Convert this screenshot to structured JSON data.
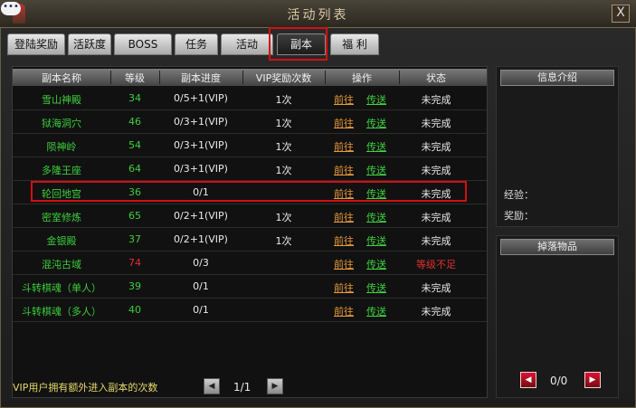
{
  "window": {
    "title": "活动列表",
    "close_label": "X"
  },
  "chat_icon": "speech-bubble-icon",
  "tabs": [
    {
      "label": "登陆奖励",
      "active": false
    },
    {
      "label": "活跃度",
      "active": false
    },
    {
      "label": "BOSS",
      "active": false
    },
    {
      "label": "任务",
      "active": false
    },
    {
      "label": "活动",
      "active": false
    },
    {
      "label": "副本",
      "active": true
    },
    {
      "label": "福 利",
      "active": false
    }
  ],
  "table": {
    "headers": [
      "副本名称",
      "等级",
      "副本进度",
      "VIP奖励次数",
      "操作",
      "状态"
    ],
    "rows": [
      {
        "name": "雪山神殿",
        "level": "34",
        "progress": "0/5+1(VIP)",
        "vip": "1次",
        "go": "前往",
        "tp": "传送",
        "status": "未完成",
        "name_color": "green",
        "level_color": "green",
        "status_color": "white"
      },
      {
        "name": "狱海洞穴",
        "level": "46",
        "progress": "0/3+1(VIP)",
        "vip": "1次",
        "go": "前往",
        "tp": "传送",
        "status": "未完成",
        "name_color": "green",
        "level_color": "green",
        "status_color": "white"
      },
      {
        "name": "陨神岭",
        "level": "54",
        "progress": "0/3+1(VIP)",
        "vip": "1次",
        "go": "前往",
        "tp": "传送",
        "status": "未完成",
        "name_color": "green",
        "level_color": "green",
        "status_color": "white"
      },
      {
        "name": "多隆王座",
        "level": "64",
        "progress": "0/3+1(VIP)",
        "vip": "1次",
        "go": "前往",
        "tp": "传送",
        "status": "未完成",
        "name_color": "green",
        "level_color": "green",
        "status_color": "white"
      },
      {
        "name": "轮回地宫",
        "level": "36",
        "progress": "0/1",
        "vip": "",
        "go": "前往",
        "tp": "传送",
        "status": "未完成",
        "name_color": "green",
        "level_color": "green",
        "status_color": "white"
      },
      {
        "name": "密室修炼",
        "level": "65",
        "progress": "0/2+1(VIP)",
        "vip": "1次",
        "go": "前往",
        "tp": "传送",
        "status": "未完成",
        "name_color": "green",
        "level_color": "green",
        "status_color": "white"
      },
      {
        "name": "金银殿",
        "level": "37",
        "progress": "0/2+1(VIP)",
        "vip": "1次",
        "go": "前往",
        "tp": "传送",
        "status": "未完成",
        "name_color": "green",
        "level_color": "green",
        "status_color": "white"
      },
      {
        "name": "混沌古域",
        "level": "74",
        "progress": "0/3",
        "vip": "",
        "go": "前往",
        "tp": "传送",
        "status": "等级不足",
        "name_color": "green",
        "level_color": "red",
        "status_color": "red"
      },
      {
        "name": "斗转棋魂（单人）",
        "level": "39",
        "progress": "0/1",
        "vip": "",
        "go": "前往",
        "tp": "传送",
        "status": "未完成",
        "name_color": "green",
        "level_color": "green",
        "status_color": "white"
      },
      {
        "name": "斗转棋魂（多人）",
        "level": "40",
        "progress": "0/1",
        "vip": "",
        "go": "前往",
        "tp": "传送",
        "status": "未完成",
        "name_color": "green",
        "level_color": "green",
        "status_color": "white"
      }
    ]
  },
  "footer": {
    "note": "VIP用户拥有额外进入副本的次数",
    "page": "1/1"
  },
  "info_panel": {
    "title": "信息介绍",
    "exp_label": "经验：",
    "reward_label": "奖励："
  },
  "drop_panel": {
    "title": "掉落物品",
    "count": "0/0"
  },
  "colors": {
    "highlight_border": "#d21010",
    "green_text": "#3cce3c",
    "red_text": "#e03030",
    "link_go": "#e89a3a",
    "link_tp": "#3fd43f"
  }
}
